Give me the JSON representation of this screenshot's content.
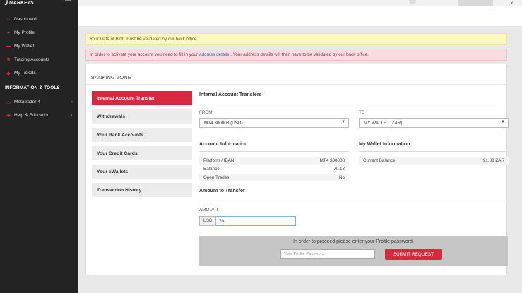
{
  "brand": {
    "name": "MARKETS",
    "mark": "J"
  },
  "sidebar": {
    "items": [
      {
        "label": "Dashboard",
        "icon": "home-icon"
      },
      {
        "label": "My Profile",
        "icon": "user-icon"
      },
      {
        "label": "My Wallet",
        "icon": "wallet-icon"
      },
      {
        "label": "Trading Accounts",
        "icon": "briefcase-icon"
      },
      {
        "label": "My Tickets",
        "icon": "ticket-icon"
      }
    ],
    "heading": "INFORMATION & TOOLS",
    "tools": [
      {
        "label": "Metatrader 4",
        "icon": "monitor-icon"
      },
      {
        "label": "Help & Education",
        "icon": "help-icon"
      }
    ]
  },
  "alerts": {
    "dob": "Your Date of Birth must be validated by our back office.",
    "address_pre": "In order to activate your account you need to fill in your",
    "address_link": "address details",
    "address_post": ". Your address details will then have to be validated by our back office."
  },
  "banking": {
    "title": "BANKING ZONE",
    "tabs": [
      "Internal Account Transfer",
      "Withdrawals",
      "Your Bank Accounts",
      "Your Credit Cards",
      "Your eWallets",
      "Transaction History"
    ]
  },
  "transfer": {
    "title": "Internal Account Transfers",
    "from_label": "FROM",
    "from_value": "MT4 300008 (USD)",
    "to_label": "TO",
    "to_value": "MY WALLET (ZAR)"
  },
  "account_info": {
    "title": "Account Information",
    "rows": [
      {
        "label": "Platform / IBAN",
        "value": "MT4 300008"
      },
      {
        "label": "Balance",
        "value": "70.13"
      },
      {
        "label": "Open Trades",
        "value": "No"
      }
    ]
  },
  "wallet_info": {
    "title": "My Wallet Information",
    "rows": [
      {
        "label": "Current Balance",
        "value": "91.88 ZAR"
      }
    ]
  },
  "amount": {
    "title": "Amount to Transfer",
    "label": "AMOUNT",
    "currency": "USD",
    "value": "70"
  },
  "submit": {
    "message": "In order to proceed please enter your Profile password.",
    "password_placeholder": "Your Profile Password",
    "button": "SUBMIT REQUEST"
  },
  "colors": {
    "accent": "#d52b3d",
    "sidebar": "#232323"
  }
}
